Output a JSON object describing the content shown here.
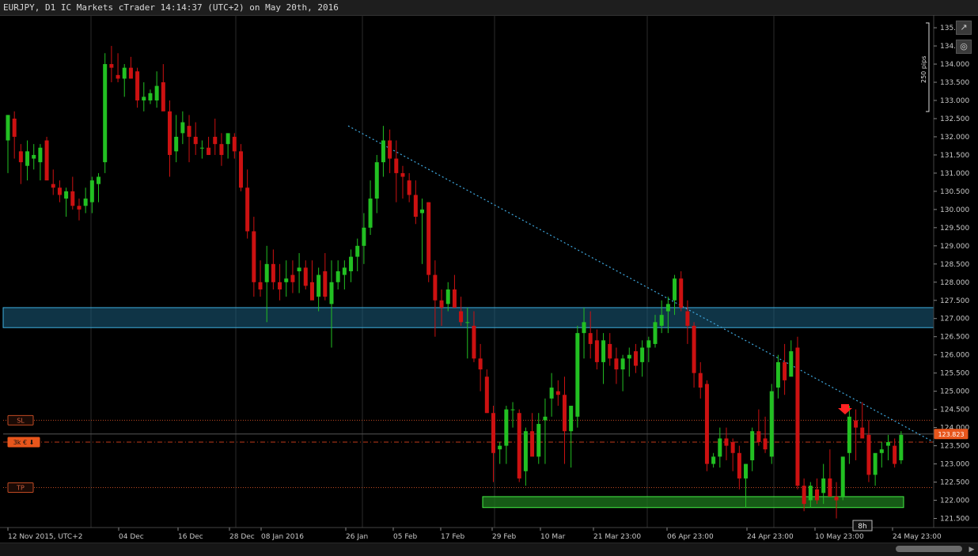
{
  "window": {
    "title": "EURJPY, D1 IC Markets cTrader 14:14:37 (UTC+2) on May 20th, 2016"
  },
  "colors": {
    "bull": "#22c022",
    "bear": "#cc1111",
    "background": "#000000",
    "grid": "#2b2b2b",
    "trendline": "#3fa9e0",
    "zone_blue": "#1c5f80",
    "zone_green": "#1d7a1d",
    "price_label": "#e8561c",
    "sl_tp": "#c04a23"
  },
  "toolbar": {
    "popout_icon": "popout-icon",
    "camera_icon": "camera-icon"
  },
  "scale": {
    "label": "250 pips"
  },
  "orders": {
    "sl_label": "SL",
    "tp_label": "TP",
    "position_label": "3k € ⬇",
    "current_price": "123.823"
  },
  "crosshair_label": "8h",
  "chart_data": {
    "type": "candlestick",
    "symbol": "EURJPY",
    "timeframe": "D1",
    "ylim": [
      121.25,
      135.35
    ],
    "y_ticks": [
      "135.000",
      "134.500",
      "134.000",
      "133.500",
      "133.000",
      "132.500",
      "132.000",
      "131.500",
      "131.000",
      "130.500",
      "130.000",
      "129.500",
      "129.000",
      "128.500",
      "128.000",
      "127.500",
      "127.000",
      "126.500",
      "126.000",
      "125.500",
      "125.000",
      "124.500",
      "124.000",
      "123.500",
      "123.000",
      "122.500",
      "122.000",
      "121.500"
    ],
    "x_labels": [
      "12 Nov 2015, UTC+2",
      "04 Dec",
      "16 Dec",
      "28 Dec",
      "08 Jan 2016",
      "26 Jan",
      "05 Feb",
      "17 Feb",
      "29 Feb",
      "10 Mar",
      "21 Mar 23:00",
      "06 Apr 23:00",
      "24 Apr 23:00",
      "10 May 23:00",
      "24 May 23:00"
    ],
    "candles": [
      [
        131.9,
        132.6,
        131.0,
        132.6
      ],
      [
        132.5,
        132.7,
        131.4,
        132.0
      ],
      [
        131.6,
        131.8,
        130.7,
        131.3
      ],
      [
        131.2,
        131.9,
        130.8,
        131.6
      ],
      [
        131.4,
        131.8,
        131.1,
        131.5
      ],
      [
        131.3,
        131.8,
        130.8,
        131.7
      ],
      [
        131.9,
        132.0,
        130.8,
        130.8
      ],
      [
        130.7,
        131.1,
        130.4,
        130.6
      ],
      [
        130.6,
        130.8,
        130.2,
        130.4
      ],
      [
        130.3,
        130.6,
        129.8,
        130.5
      ],
      [
        130.5,
        130.9,
        130.0,
        130.1
      ],
      [
        130.1,
        130.3,
        129.7,
        130.0
      ],
      [
        130.1,
        130.6,
        129.9,
        130.3
      ],
      [
        130.2,
        130.9,
        129.9,
        130.8
      ],
      [
        130.7,
        131.0,
        130.2,
        130.9
      ],
      [
        131.3,
        134.3,
        131.0,
        134.0
      ],
      [
        134.0,
        134.5,
        133.5,
        133.9
      ],
      [
        133.7,
        134.3,
        133.5,
        133.6
      ],
      [
        133.6,
        134.0,
        133.1,
        133.9
      ],
      [
        133.9,
        134.2,
        133.6,
        133.6
      ],
      [
        133.8,
        133.9,
        132.8,
        133.0
      ],
      [
        133.0,
        133.5,
        132.7,
        133.1
      ],
      [
        133.0,
        133.3,
        132.9,
        133.2
      ],
      [
        133.0,
        133.8,
        132.8,
        133.4
      ],
      [
        133.5,
        134.0,
        133.0,
        132.7
      ],
      [
        132.7,
        133.0,
        130.9,
        131.5
      ],
      [
        131.6,
        132.6,
        131.3,
        132.0
      ],
      [
        132.1,
        132.7,
        131.8,
        132.4
      ],
      [
        132.3,
        132.6,
        131.3,
        132.0
      ],
      [
        132.0,
        132.4,
        131.5,
        131.8
      ],
      [
        131.7,
        131.9,
        131.4,
        131.7
      ],
      [
        131.7,
        132.0,
        131.5,
        131.5
      ],
      [
        132.0,
        132.5,
        131.5,
        131.8
      ],
      [
        131.8,
        132.1,
        131.2,
        131.5
      ],
      [
        131.8,
        132.0,
        131.4,
        132.1
      ],
      [
        132.0,
        132.1,
        131.4,
        131.6
      ],
      [
        131.6,
        131.8,
        130.5,
        130.6
      ],
      [
        130.6,
        131.1,
        129.2,
        129.4
      ],
      [
        129.4,
        129.8,
        127.6,
        128.0
      ],
      [
        128.0,
        128.6,
        127.6,
        127.8
      ],
      [
        128.0,
        129.0,
        126.9,
        128.5
      ],
      [
        128.5,
        128.9,
        127.8,
        128.0
      ],
      [
        128.0,
        128.5,
        127.5,
        127.8
      ],
      [
        128.0,
        128.6,
        127.6,
        128.1
      ],
      [
        128.2,
        128.6,
        127.7,
        128.0
      ],
      [
        128.3,
        128.8,
        127.7,
        128.4
      ],
      [
        128.4,
        128.6,
        127.8,
        127.9
      ],
      [
        128.0,
        128.6,
        127.6,
        127.5
      ],
      [
        127.6,
        128.4,
        127.2,
        128.2
      ],
      [
        128.3,
        128.8,
        127.5,
        127.6
      ],
      [
        127.4,
        128.6,
        126.2,
        128.0
      ],
      [
        128.0,
        128.6,
        127.8,
        128.3
      ],
      [
        128.2,
        128.6,
        127.8,
        128.4
      ],
      [
        128.3,
        128.9,
        128.0,
        128.7
      ],
      [
        128.7,
        129.2,
        128.3,
        129.0
      ],
      [
        129.0,
        129.9,
        128.5,
        129.5
      ],
      [
        129.5,
        130.8,
        129.3,
        130.3
      ],
      [
        130.3,
        131.5,
        129.9,
        131.3
      ],
      [
        131.3,
        132.3,
        130.9,
        131.9
      ],
      [
        131.9,
        132.2,
        131.0,
        131.4
      ],
      [
        131.4,
        131.9,
        130.2,
        131.0
      ],
      [
        131.0,
        131.2,
        130.3,
        130.9
      ],
      [
        130.8,
        131.0,
        130.2,
        130.4
      ],
      [
        130.4,
        130.8,
        129.6,
        129.8
      ],
      [
        129.9,
        130.3,
        128.5,
        130.0
      ],
      [
        130.2,
        130.2,
        128.0,
        128.2
      ],
      [
        128.2,
        128.6,
        126.5,
        127.5
      ],
      [
        127.5,
        127.8,
        126.8,
        127.3
      ],
      [
        127.4,
        128.0,
        127.2,
        127.8
      ],
      [
        127.8,
        128.2,
        127.3,
        127.3
      ],
      [
        127.2,
        127.6,
        126.8,
        126.9
      ],
      [
        126.9,
        127.3,
        125.9,
        126.9
      ],
      [
        126.8,
        127.2,
        125.8,
        125.9
      ],
      [
        125.9,
        126.3,
        125.0,
        125.6
      ],
      [
        125.4,
        125.6,
        124.4,
        124.4
      ],
      [
        124.4,
        124.6,
        122.5,
        123.3
      ],
      [
        123.4,
        123.6,
        123.0,
        123.5
      ],
      [
        123.5,
        124.6,
        123.0,
        124.5
      ],
      [
        124.5,
        124.7,
        124.0,
        124.5
      ],
      [
        124.4,
        124.5,
        122.5,
        122.6
      ],
      [
        122.8,
        124.0,
        122.4,
        123.9
      ],
      [
        123.9,
        124.4,
        123.3,
        123.2
      ],
      [
        123.2,
        124.4,
        123.0,
        124.1
      ],
      [
        124.2,
        124.8,
        123.0,
        124.3
      ],
      [
        124.8,
        125.5,
        124.3,
        125.1
      ],
      [
        125.0,
        125.3,
        124.6,
        124.9
      ],
      [
        124.9,
        125.4,
        123.0,
        123.9
      ],
      [
        123.9,
        124.6,
        122.9,
        124.6
      ],
      [
        124.3,
        126.8,
        124.0,
        126.6
      ],
      [
        126.6,
        127.3,
        125.9,
        126.9
      ],
      [
        126.6,
        127.2,
        125.9,
        126.3
      ],
      [
        126.4,
        126.7,
        125.6,
        125.8
      ],
      [
        125.8,
        126.6,
        125.2,
        126.4
      ],
      [
        126.3,
        126.6,
        125.7,
        125.9
      ],
      [
        125.9,
        126.2,
        125.2,
        125.6
      ],
      [
        125.6,
        126.0,
        125.0,
        125.9
      ],
      [
        125.9,
        126.2,
        125.4,
        126.0
      ],
      [
        126.1,
        126.3,
        125.5,
        125.7
      ],
      [
        125.8,
        126.4,
        125.4,
        126.2
      ],
      [
        126.2,
        126.5,
        125.8,
        126.4
      ],
      [
        126.3,
        127.1,
        126.2,
        126.9
      ],
      [
        126.8,
        127.5,
        126.6,
        127.1
      ],
      [
        127.2,
        127.6,
        126.6,
        127.4
      ],
      [
        127.5,
        128.2,
        127.1,
        128.1
      ],
      [
        128.1,
        128.3,
        127.2,
        127.3
      ],
      [
        127.2,
        127.5,
        126.3,
        126.8
      ],
      [
        126.8,
        126.9,
        125.1,
        125.5
      ],
      [
        125.5,
        125.8,
        124.8,
        125.1
      ],
      [
        125.2,
        125.3,
        122.8,
        123.0
      ],
      [
        123.0,
        123.3,
        122.9,
        123.2
      ],
      [
        123.2,
        124.0,
        122.9,
        123.7
      ],
      [
        123.7,
        124.0,
        123.1,
        123.5
      ],
      [
        123.6,
        123.7,
        122.8,
        123.3
      ],
      [
        123.3,
        123.5,
        122.3,
        122.6
      ],
      [
        122.6,
        123.0,
        121.8,
        123.0
      ],
      [
        123.1,
        124.0,
        122.8,
        123.9
      ],
      [
        123.9,
        124.5,
        123.5,
        123.6
      ],
      [
        123.7,
        124.3,
        123.3,
        123.4
      ],
      [
        123.2,
        125.2,
        123.0,
        125.0
      ],
      [
        125.1,
        126.0,
        124.8,
        125.8
      ],
      [
        125.8,
        126.3,
        124.9,
        125.3
      ],
      [
        125.4,
        126.4,
        125.7,
        126.1
      ],
      [
        126.2,
        126.5,
        122.3,
        122.4
      ],
      [
        122.4,
        122.6,
        121.7,
        121.9
      ],
      [
        122.0,
        122.5,
        121.8,
        122.4
      ],
      [
        122.3,
        122.6,
        121.9,
        122.0
      ],
      [
        122.2,
        123.0,
        121.9,
        122.6
      ],
      [
        122.6,
        123.4,
        122.2,
        122.1
      ],
      [
        122.1,
        122.5,
        121.5,
        122.0
      ],
      [
        122.1,
        123.2,
        122.0,
        123.2
      ],
      [
        123.3,
        124.6,
        123.0,
        124.3
      ],
      [
        124.2,
        124.5,
        123.1,
        124.0
      ],
      [
        124.0,
        124.7,
        123.8,
        123.7
      ],
      [
        123.8,
        124.2,
        122.5,
        122.7
      ],
      [
        122.7,
        123.2,
        122.4,
        123.3
      ],
      [
        123.3,
        123.6,
        122.9,
        123.4
      ],
      [
        123.5,
        123.8,
        123.1,
        123.6
      ],
      [
        123.5,
        123.7,
        122.9,
        123.0
      ],
      [
        123.1,
        123.9,
        123.0,
        123.8
      ]
    ],
    "trendline": {
      "from": [
        132.3,
        "26 Jan"
      ],
      "to": [
        123.6,
        "24 May 23:00"
      ],
      "style": "dotted"
    },
    "resistance_zone": [
      126.75,
      127.3
    ],
    "support_zone": [
      121.8,
      122.1
    ],
    "horizontal_lines": {
      "sl": 124.2,
      "entry": 123.6,
      "tp": 122.35,
      "current": 123.823
    },
    "grid": "vertical-only"
  }
}
